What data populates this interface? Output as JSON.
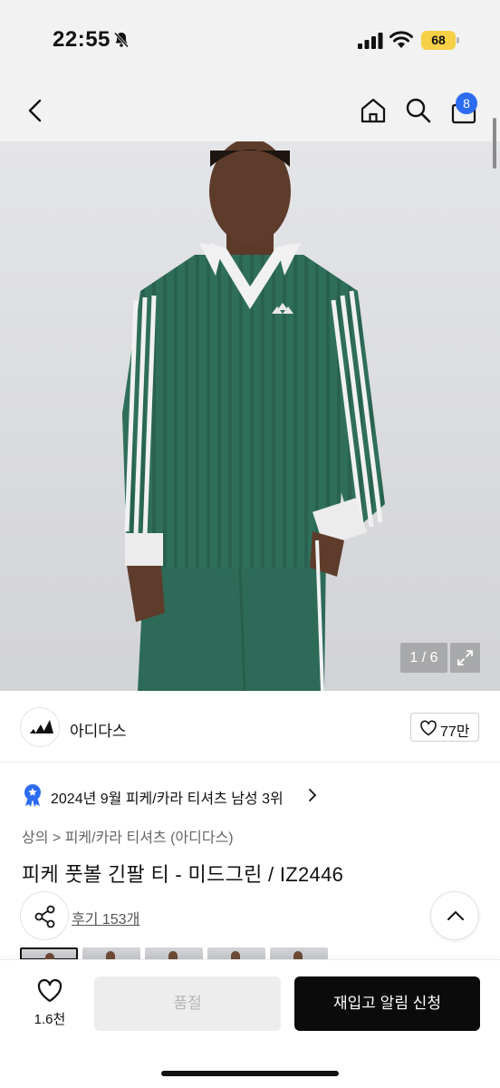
{
  "status_bar": {
    "time": "22:55",
    "battery": "68",
    "icons": [
      "bell-slash-icon",
      "signal-icon",
      "wifi-icon"
    ]
  },
  "nav": {
    "icons": [
      "chevron-left-icon",
      "home-icon",
      "search-icon",
      "bag-icon"
    ],
    "cart_count": "8"
  },
  "gallery": {
    "counter": "1 / 6",
    "expand_icon": "expand-icon",
    "thumbnail_count": 5
  },
  "brand": {
    "name": "아디다스",
    "likes": "77만"
  },
  "ranking": {
    "text": "2024년 9월 피케/카라 티셔츠 남성 3위"
  },
  "breadcrumb": {
    "category": "상의",
    "subcategory": "피케/카라 티셔츠 (아디다스)"
  },
  "product": {
    "title": "피케 풋볼 긴팔 티 - 미드그린 / IZ2446",
    "reviews": "후기 153개"
  },
  "bottom": {
    "wish_count": "1.6천",
    "soldout_label": "품절",
    "restock_label": "재입고 알림 신청"
  },
  "colors": {
    "jersey": "#2f6f5a",
    "accent_badge": "#2d6cf0",
    "primary_button": "#0b0b0b"
  }
}
